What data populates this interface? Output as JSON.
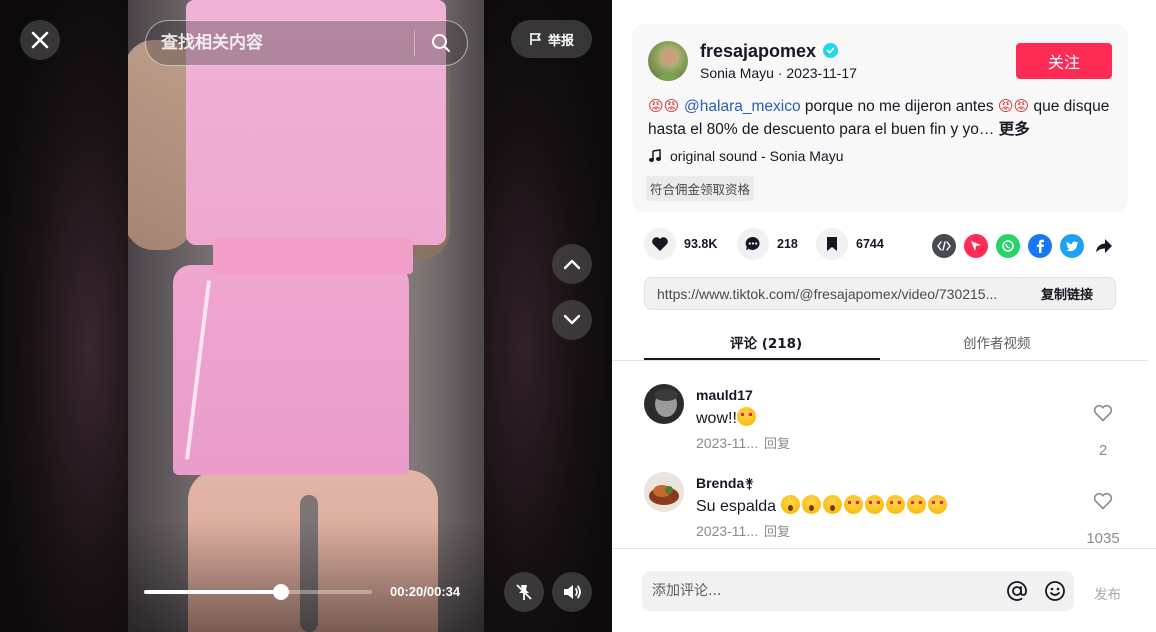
{
  "video": {
    "search_placeholder": "查找相关内容",
    "report_label": "举报",
    "progress_fraction": 0.6,
    "time_display": "00:20/00:34"
  },
  "author": {
    "username": "fresajapomex",
    "display_name": "Sonia Mayu",
    "separator": " · ",
    "date": "2023-11-17",
    "follow_label": "关注"
  },
  "caption": {
    "mention": "@halara_mexico",
    "text_part1": " porque no me dijeron antes ",
    "text_part2": " que disque hasta el 80% de descuento para el buen fin y yo…",
    "more_label": " 更多",
    "sound": "original sound - Sonia Mayu",
    "tag": "符合佣金领取资格"
  },
  "stats": {
    "likes": "93.8K",
    "comments": "218",
    "saves": "6744"
  },
  "link": {
    "url": "https://www.tiktok.com/@fresajapomex/video/730215...",
    "copy_label": "复制链接"
  },
  "tabs": {
    "comments": "评论 (218)",
    "creator_videos": "创作者视频"
  },
  "comments": [
    {
      "user": "mauld17",
      "text": "wow!!",
      "date": "2023-11...",
      "reply": "回复",
      "likes": "2"
    },
    {
      "user": "Brenda⚵",
      "text": "Su espalda ",
      "date": "2023-11...",
      "reply": "回复",
      "likes": "1035"
    }
  ],
  "comment_input": {
    "placeholder": "添加评论...",
    "post_label": "发布"
  },
  "colors": {
    "follow": "#fe2c55",
    "mention": "#2b5db9",
    "verified": "#20d5ec"
  }
}
